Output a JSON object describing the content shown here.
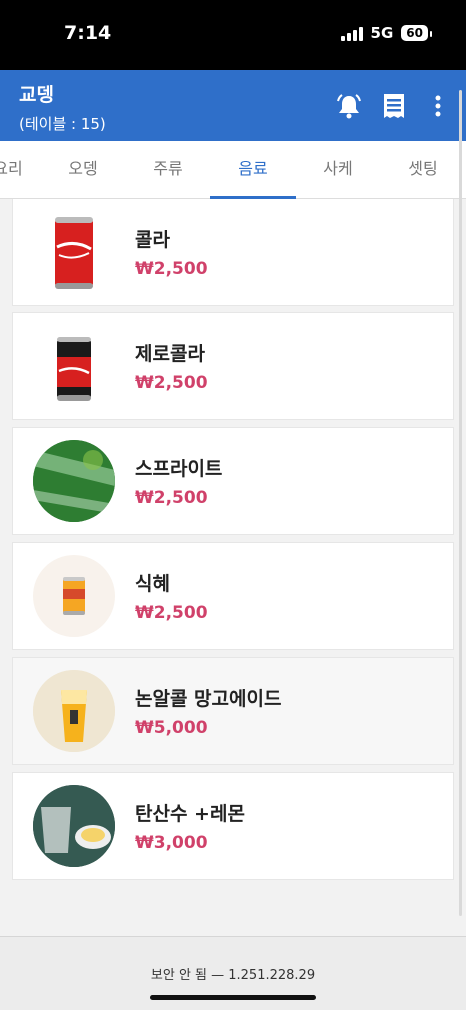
{
  "status_bar": {
    "time": "7:14",
    "network": "5G",
    "battery": "60"
  },
  "header": {
    "title": "교뎅",
    "table_label": "(테이블 : 15)"
  },
  "tabs": [
    {
      "label": "요리"
    },
    {
      "label": "오뎅"
    },
    {
      "label": "주류"
    },
    {
      "label": "음료",
      "active": true
    },
    {
      "label": "사케"
    },
    {
      "label": "셋팅"
    }
  ],
  "menu": {
    "items": [
      {
        "name": "콜라",
        "price": "₩2,500"
      },
      {
        "name": "제로콜라",
        "price": "₩2,500"
      },
      {
        "name": "스프라이트",
        "price": "₩2,500"
      },
      {
        "name": "식혜",
        "price": "₩2,500"
      },
      {
        "name": "논알콜 망고에이드",
        "price": "₩5,000"
      },
      {
        "name": "탄산수 +레몬",
        "price": "₩3,000"
      }
    ]
  },
  "browser": {
    "url_text": "보안 안 됨 — 1.251.228.29"
  },
  "colors": {
    "header": "#2f6fc9",
    "price": "#d0416a",
    "active_tab": "#2f6fc9"
  }
}
